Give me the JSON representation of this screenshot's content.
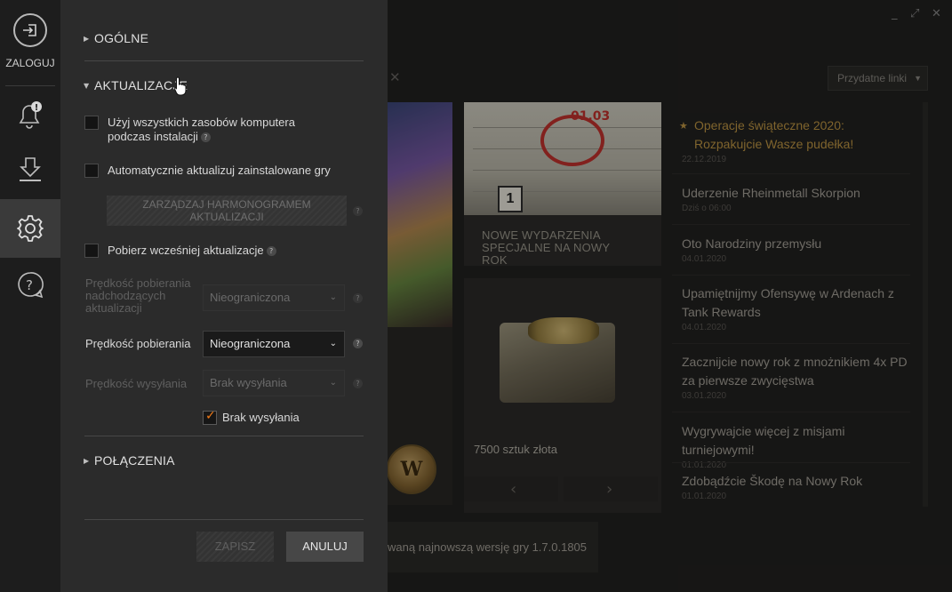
{
  "window": {
    "minimize": "_",
    "maximize": "⤢",
    "close": "✕"
  },
  "background": {
    "useful_links": "Przydatne linki",
    "event_card": "NOWE WYDARZENIA SPECJALNE NA NOWY ROK",
    "calendar_date": "01.03",
    "calendar_box": "1",
    "gold_label": "7500 sztuk złota",
    "version_text": "waną najnowszą wersję gry  1.7.0.1805",
    "news": [
      {
        "title": "Operacje świąteczne 2020: Rozpakujcie Wasze pudełka!",
        "date": "22.12.2019",
        "highlight": true
      },
      {
        "title": "Uderzenie Rheinmetall Skorpion",
        "date": "Dziś o 06:00",
        "highlight": false
      },
      {
        "title": "Oto Narodziny przemysłu",
        "date": "04.01.2020",
        "highlight": false
      },
      {
        "title": "Upamiętnijmy Ofensywę w Ardenach z Tank Rewards",
        "date": "04.01.2020",
        "highlight": false
      },
      {
        "title": "Zacznijcie nowy rok z mnożnikiem 4x PD za pierwsze zwycięstwa",
        "date": "03.01.2020",
        "highlight": false
      },
      {
        "title": "Wygrywajcie więcej z misjami turniejowymi!",
        "date": "01.01.2020",
        "highlight": false
      },
      {
        "title": "Zdobądźcie Škodę na Nowy Rok",
        "date": "01.01.2020",
        "highlight": false
      }
    ]
  },
  "nav": {
    "login_label": "ZALOGUJ",
    "icons": [
      "login-icon",
      "bell-icon",
      "download-icon",
      "gear-icon",
      "help-icon"
    ],
    "notification_badge": "!"
  },
  "settings": {
    "general": "OGÓLNE",
    "updates": "AKTUALIZACJE",
    "use_all_resources": "Użyj wszystkich zasobów komputera podczas instalacji",
    "auto_update": "Automatycznie aktualizuj zainstalowane gry",
    "manage_schedule": "ZARZĄDZAJ HARMONOGRAMEM AKTUALIZACJI",
    "preload": "Pobierz wcześniej aktualizacje",
    "preload_speed_label": "Prędkość pobierania nadchodzących aktualizacji",
    "preload_speed_value": "Nieograniczona",
    "download_speed_label": "Prędkość pobierania",
    "download_speed_value": "Nieograniczona",
    "upload_speed_label": "Prędkość wysyłania",
    "upload_speed_value": "Brak wysyłania",
    "no_upload": "Brak wysyłania",
    "no_upload_checked": true,
    "connections": "POŁĄCZENIA",
    "save": "ZAPISZ",
    "cancel": "ANULUJ",
    "help_glyph": "?"
  },
  "colors": {
    "accent_orange": "#f07a18",
    "news_highlight": "#c49a45",
    "panel_bg": "#2b2b2b"
  }
}
